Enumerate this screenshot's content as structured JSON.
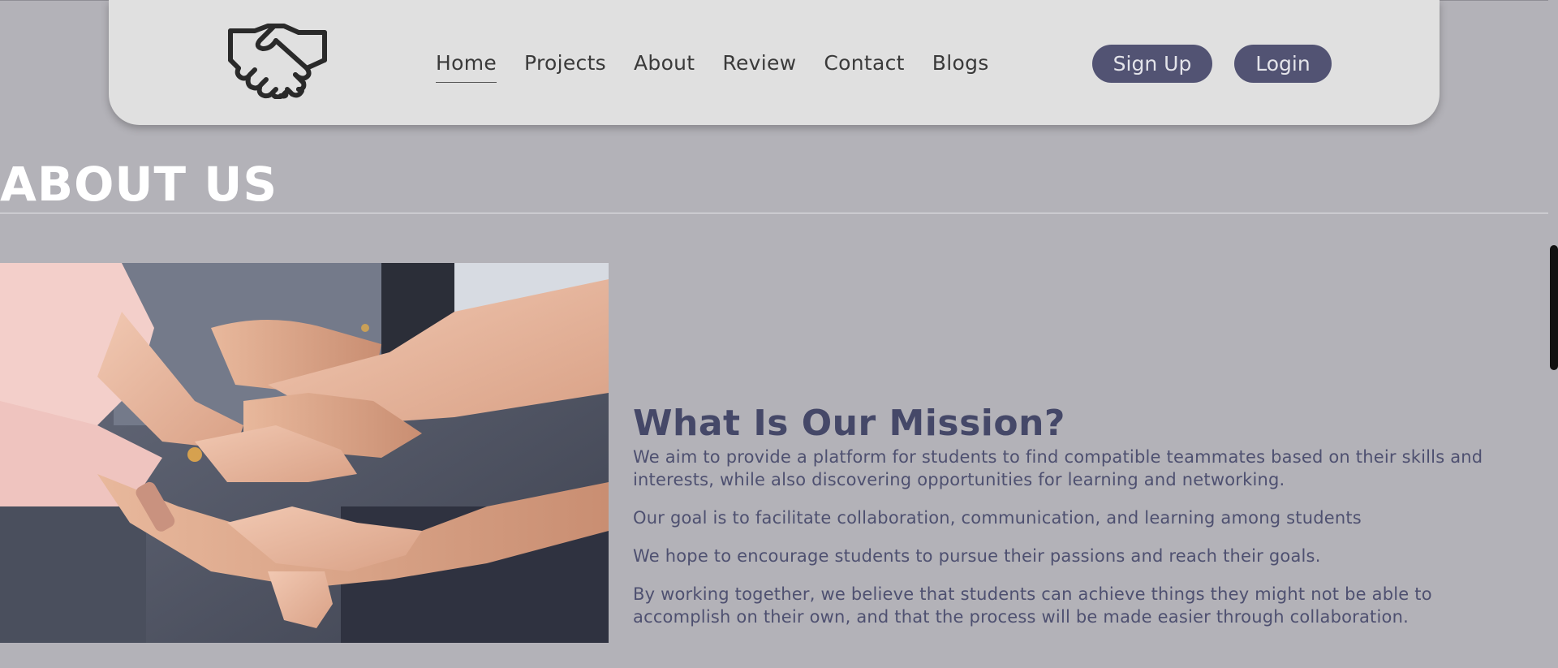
{
  "nav": {
    "links": [
      "Home",
      "Projects",
      "About",
      "Review",
      "Contact",
      "Blogs"
    ],
    "signup_label": "Sign Up",
    "login_label": "Login"
  },
  "about": {
    "title": "ABOUT US"
  },
  "mission": {
    "title": "What Is Our Mission?",
    "paragraphs": [
      "We aim to provide a platform for students to find compatible teammates based on their skills and interests, while also discovering opportunities for learning and networking.",
      "Our goal is to facilitate collaboration, communication, and learning among students",
      "We hope to encourage students to pursue their passions and reach their goals.",
      "By working together, we believe that students can achieve things they might not be able to accomplish on their own, and that the process will be made easier through collaboration."
    ]
  },
  "colors": {
    "page_bg": "#b3b2b8",
    "navbar_bg": "#e0e0e0",
    "button_bg": "#525373",
    "heading": "#454868"
  },
  "icons": {
    "logo": "handshake-icon"
  }
}
